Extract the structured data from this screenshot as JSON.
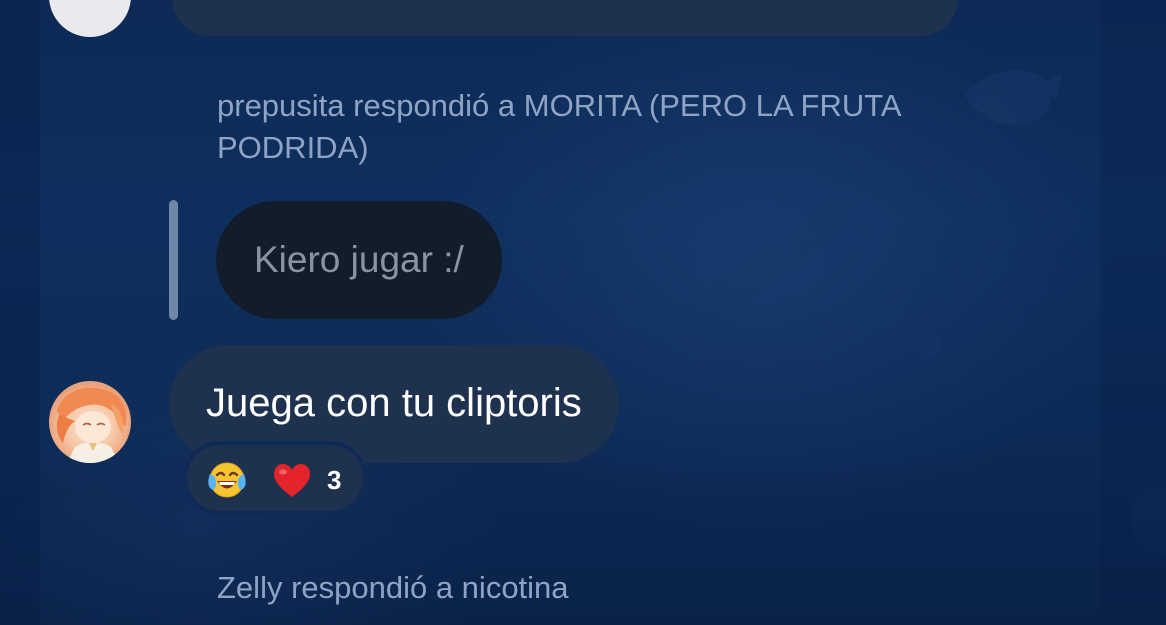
{
  "messages": [
    {
      "id": "top-message",
      "text": ""
    },
    {
      "id": "prepusita-reply",
      "reply_header": "prepusita respondió a MORITA (PERO LA FRUTA PODRIDA)",
      "quoted_text": "Kiero jugar :/",
      "text": "Juega con tu cliptoris",
      "reactions": {
        "emojis": [
          "face-with-tears-of-joy-icon",
          "red-heart-icon"
        ],
        "count": "3"
      }
    },
    {
      "id": "zelly-reply",
      "reply_header": "Zelly respondió a nicotina"
    }
  ],
  "colors": {
    "background": "#0e2f5e",
    "bubble": "#1e3250",
    "quoted_bubble": "#121c2a",
    "reply_header_text": "#8fa4c4",
    "message_text": "#ffffff",
    "quoted_text": "#8b93a0",
    "quote_bar": "#6f86a6"
  }
}
